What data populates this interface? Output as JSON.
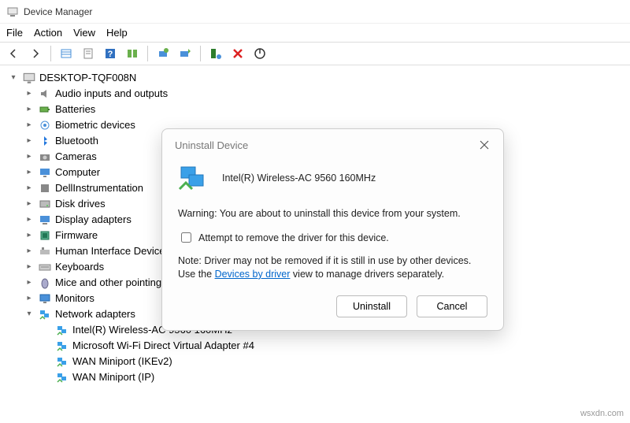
{
  "window": {
    "title": "Device Manager"
  },
  "menu": {
    "file": "File",
    "action": "Action",
    "view": "View",
    "help": "Help"
  },
  "toolbar_icons": {
    "back": "back-icon",
    "forward": "forward-icon",
    "show_hidden": "show-hidden-icon",
    "properties": "properties-icon",
    "help": "help-icon",
    "resources": "resources-icon",
    "scan": "scan-icon",
    "update_driver": "update-driver-icon",
    "add_driver": "add-driver-icon",
    "uninstall": "uninstall-icon",
    "disable": "disable-icon"
  },
  "tree": {
    "root": "DESKTOP-TQF008N",
    "categories": [
      {
        "label": "Audio inputs and outputs",
        "expanded": false
      },
      {
        "label": "Batteries",
        "expanded": false
      },
      {
        "label": "Biometric devices",
        "expanded": false
      },
      {
        "label": "Bluetooth",
        "expanded": false
      },
      {
        "label": "Cameras",
        "expanded": false
      },
      {
        "label": "Computer",
        "expanded": false
      },
      {
        "label": "DellInstrumentation",
        "expanded": false
      },
      {
        "label": "Disk drives",
        "expanded": false
      },
      {
        "label": "Display adapters",
        "expanded": false
      },
      {
        "label": "Firmware",
        "expanded": false
      },
      {
        "label": "Human Interface Devices",
        "expanded": false
      },
      {
        "label": "Keyboards",
        "expanded": false
      },
      {
        "label": "Mice and other pointing devices",
        "expanded": false
      },
      {
        "label": "Monitors",
        "expanded": false
      },
      {
        "label": "Network adapters",
        "expanded": true,
        "children": [
          "Intel(R) Wireless-AC 9560 160MHz",
          "Microsoft Wi-Fi Direct Virtual Adapter #4",
          "WAN Miniport (IKEv2)",
          "WAN Miniport (IP)"
        ]
      }
    ]
  },
  "dialog": {
    "title": "Uninstall Device",
    "device_name": "Intel(R) Wireless-AC 9560 160MHz",
    "warning": "Warning: You are about to uninstall this device from your system.",
    "checkbox_label": "Attempt to remove the driver for this device.",
    "note_prefix": "Note: Driver may not be removed if it is still in use by other devices. Use the ",
    "note_link": "Devices by driver",
    "note_suffix": " view to manage drivers separately.",
    "btn_uninstall": "Uninstall",
    "btn_cancel": "Cancel"
  },
  "watermark": "wsxdn.com"
}
